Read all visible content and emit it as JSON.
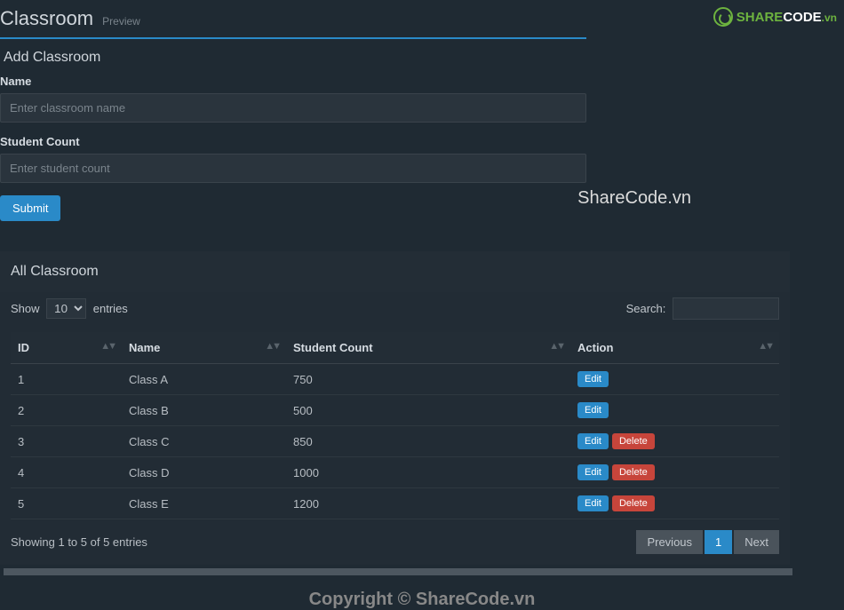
{
  "header": {
    "title": "Classroom",
    "subtitle": "Preview"
  },
  "form": {
    "panel_title": "Add Classroom",
    "name_label": "Name",
    "name_placeholder": "Enter classroom name",
    "count_label": "Student Count",
    "count_placeholder": "Enter student count",
    "submit_label": "Submit"
  },
  "watermark": {
    "text": "ShareCode.vn",
    "logo_share": "SHARE",
    "logo_code": "CODE",
    "logo_vn": ".vn"
  },
  "table": {
    "panel_title": "All Classroom",
    "show_label": "Show",
    "entries_label": "entries",
    "entries_value": "10",
    "search_label": "Search:",
    "columns": {
      "id": "ID",
      "name": "Name",
      "count": "Student Count",
      "action": "Action"
    },
    "rows": [
      {
        "id": "1",
        "name": "Class A",
        "count": "750",
        "actions": [
          "Edit"
        ]
      },
      {
        "id": "2",
        "name": "Class B",
        "count": "500",
        "actions": [
          "Edit"
        ]
      },
      {
        "id": "3",
        "name": "Class C",
        "count": "850",
        "actions": [
          "Edit",
          "Delete"
        ]
      },
      {
        "id": "4",
        "name": "Class D",
        "count": "1000",
        "actions": [
          "Edit",
          "Delete"
        ]
      },
      {
        "id": "5",
        "name": "Class E",
        "count": "1200",
        "actions": [
          "Edit",
          "Delete"
        ]
      }
    ],
    "info": "Showing 1 to 5 of 5 entries",
    "pagination": {
      "prev": "Previous",
      "page": "1",
      "next": "Next"
    }
  },
  "footer": {
    "copyright": "Copyright © ShareCode.vn"
  }
}
